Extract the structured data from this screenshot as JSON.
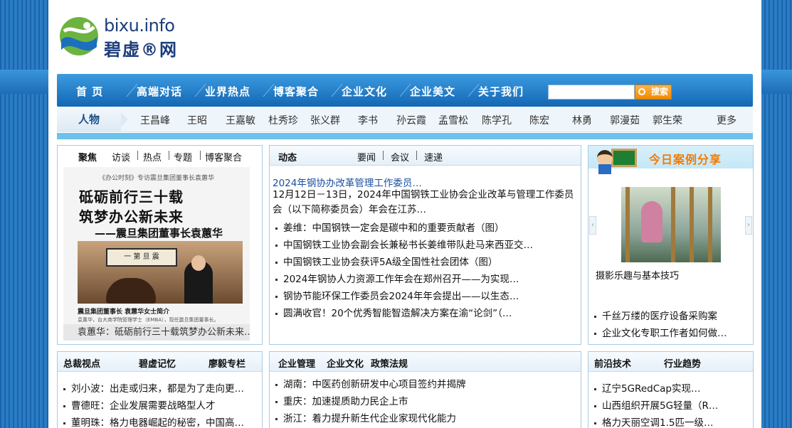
{
  "logo": {
    "en": "bixu.info",
    "cn": "碧虚®网"
  },
  "nav": {
    "items": [
      "首 页",
      "高端对话",
      "业界热点",
      "博客聚合",
      "企业文化",
      "企业美文",
      "关于我们"
    ],
    "search_button": "搜索",
    "search_placeholder": ""
  },
  "people": {
    "label": "人物",
    "names": [
      "王昌峰",
      "王昭",
      "王嘉敏",
      "杜秀珍",
      "张义群",
      "李书",
      "孙云霞",
      "孟雪松",
      "陈学孔",
      "陈宏",
      "林勇",
      "郭漫茹",
      "郭生荣"
    ],
    "more": "更多"
  },
  "focus": {
    "tabs": [
      "聚焦",
      "访谈",
      "热点",
      "专题",
      "博客聚合"
    ],
    "image": {
      "small": "《办公时刻》专访震旦集团董事长袁蕙华",
      "line1": "砥砺前行三十载",
      "line2": "筑梦办公新未来",
      "line3": "——震旦集团董事长袁蕙华",
      "frame": "一 第 旦 震",
      "caption1": "震旦集团董事长 袁蕙华女士简介",
      "caption2": "袁蕙华，台大商学院管理学士（EMBA），现任震旦集团董事长。"
    },
    "caption": "袁蕙华：砥砺前行三十载筑梦办公新未来…"
  },
  "news": {
    "title": "动态",
    "tabs": [
      "要闻",
      "会议",
      "速递"
    ],
    "headline": "2024年钢协办改革管理工作委员…",
    "summary": "12月12日－13日，2024年中国钢铁工业协会企业改革与管理工作委员会（以下简称委员会）年会在江苏…",
    "items": [
      "姜维：中国钢铁一定会是碳中和的重要贡献者（图）",
      "中国钢铁工业协会副会长兼秘书长姜维带队赴马来西亚交…",
      "中国钢铁工业协会获评5A级全国性社会团体（图）",
      "2024年钢协人力资源工作年会在郑州召开——为实现…",
      "钢协节能环保工作委员会2024年年会提出——以生态…",
      "圆满收官！20个优秀智能智造解决方案在渝“论剑”（…"
    ]
  },
  "case": {
    "title": "今日案例分享",
    "img_caption": "摄影乐趣与基本技巧",
    "items": [
      "千丝万缕的医疗设备采购案",
      "企业文化专职工作者如何做…"
    ]
  },
  "ceo": {
    "tabs": [
      "总裁视点",
      "碧虚记忆",
      "廖毅专栏"
    ],
    "items": [
      "刘小波：出走或归来，都是为了走向更…",
      "曹德旺：企业发展需要战略型人才",
      "董明珠：格力电器崛起的秘密，中国高…"
    ]
  },
  "mgmt": {
    "tabs": [
      "企业管理",
      "企业文化",
      "政策法规"
    ],
    "items": [
      "湖南：中医药创新研发中心项目签约并揭牌",
      "重庆：加速提质助力民企上市",
      "浙江：着力提升新生代企业家现代化能力"
    ]
  },
  "tech": {
    "tabs": [
      "前沿技术",
      "行业趋势"
    ],
    "items": [
      "辽宁5GRedCap实现…",
      "山西组织开展5G轻量（R…",
      "格力天丽空调1.5匹一级…"
    ]
  }
}
